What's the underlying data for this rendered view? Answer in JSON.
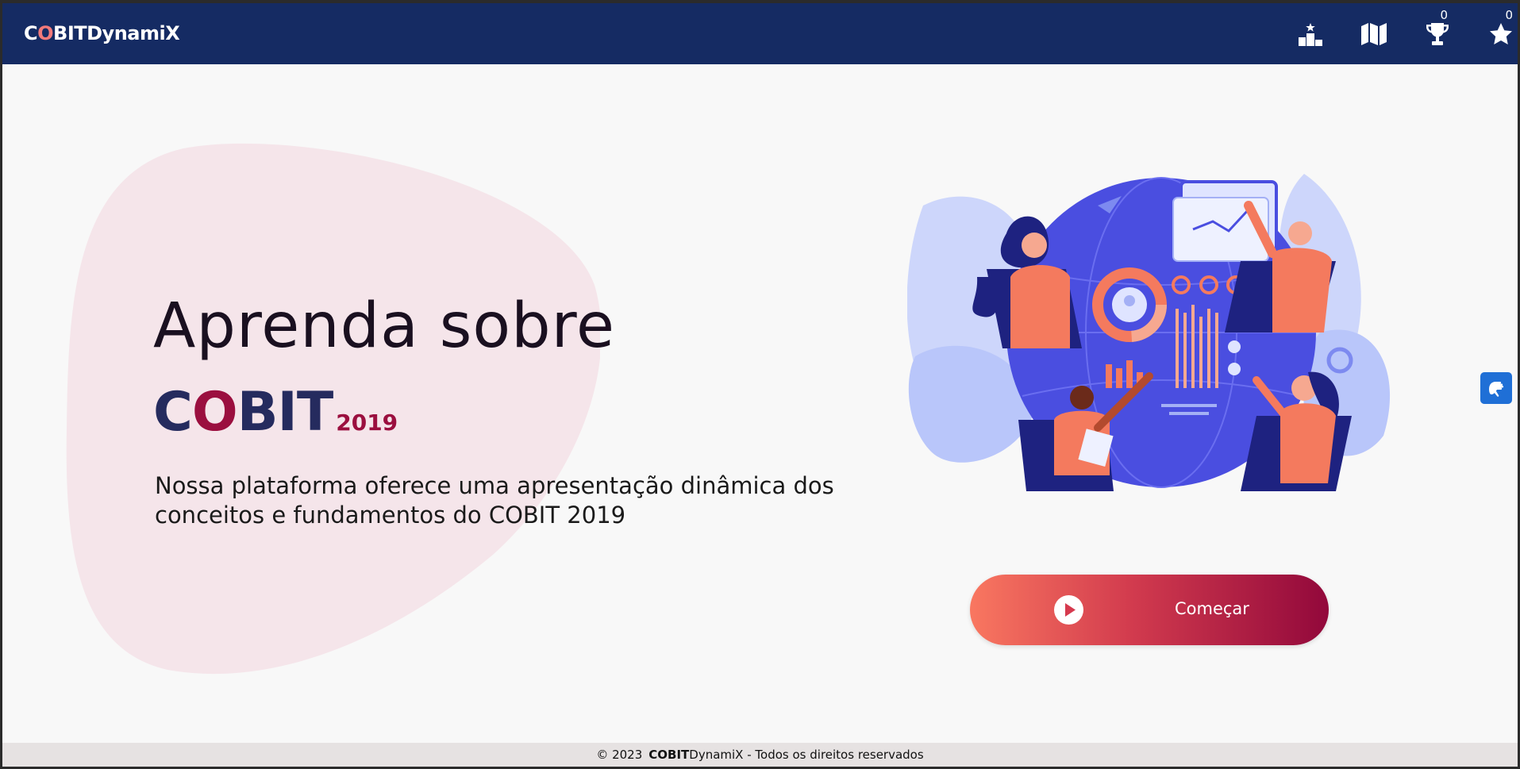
{
  "navbar": {
    "brand_c": "C",
    "brand_o": "O",
    "brand_rest": "BITDynamiX",
    "icons": [
      "podium-icon",
      "map-icon",
      "trophy-icon",
      "star-icon"
    ],
    "trophy_count": "0",
    "star_count": "0"
  },
  "hero": {
    "title": "Aprenda sobre",
    "cobit_c": "C",
    "cobit_o": "O",
    "cobit_rest": "BIT",
    "cobit_year": "2019",
    "description": "Nossa plataforma oferece uma apresentação dinâmica dos conceitos e fundamentos do COBIT 2019"
  },
  "cta": {
    "label": "Começar",
    "icon": "play-icon"
  },
  "accessibility": {
    "icon": "sign-language-icon"
  },
  "footer": {
    "copyright": "© 2023",
    "brand_bold": "COBIT",
    "brand_rest": "DynamiX",
    "rights": " - Todos os direitos reservados"
  },
  "colors": {
    "navbar_bg": "#152b63",
    "accent_red": "#9b0f3f",
    "accent_navy": "#252b5e",
    "cta_start": "#f97760",
    "cta_end": "#92083b",
    "blob": "#f5e5ea",
    "footer_bg": "#e6e2e2"
  }
}
